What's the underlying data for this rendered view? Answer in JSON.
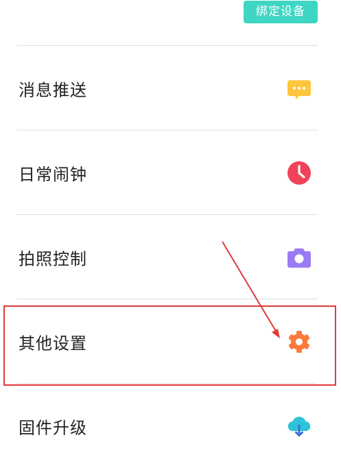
{
  "header": {
    "bind_device_label": "绑定设备"
  },
  "menu": {
    "items": [
      {
        "label": "消息推送",
        "icon": "message-bubble-icon",
        "color": "#ffc53d"
      },
      {
        "label": "日常闹钟",
        "icon": "clock-icon",
        "color": "#f0435a"
      },
      {
        "label": "拍照控制",
        "icon": "camera-icon",
        "color": "#9b7bf2"
      },
      {
        "label": "其他设置",
        "icon": "gear-icon",
        "color": "#fb7a3c"
      },
      {
        "label": "固件升级",
        "icon": "cloud-download-icon",
        "color": "#2fc3d9"
      }
    ]
  },
  "annotation": {
    "highlight_color": "#e03a3a"
  }
}
